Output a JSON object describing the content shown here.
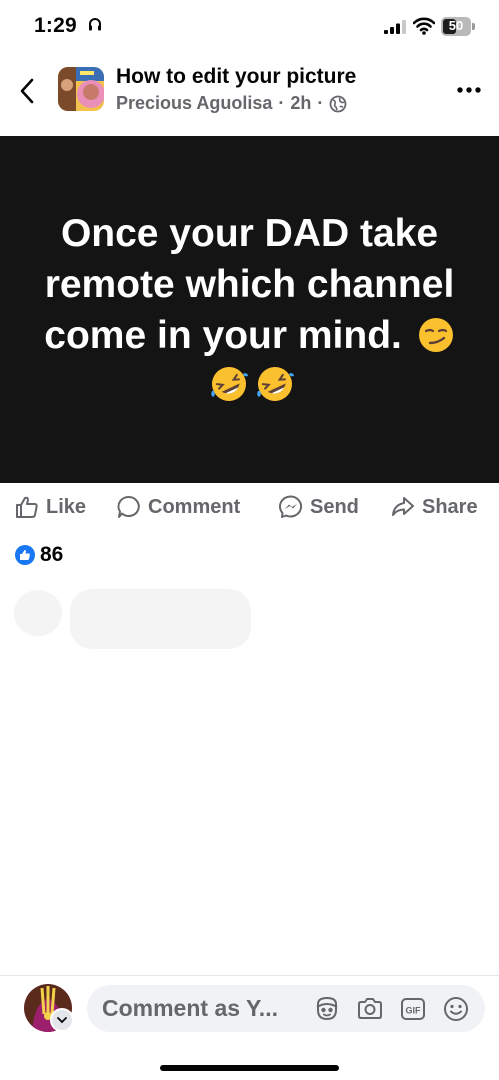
{
  "status_bar": {
    "time": "1:29",
    "battery": "50",
    "battery_level": 0.5
  },
  "header": {
    "title": "How to edit your picture",
    "author": "Precious Aguolisa",
    "time_ago": "2h",
    "separator": "·"
  },
  "post": {
    "text": "Once your DAD take remote which channel come in your mind.",
    "emojis": [
      "smirking-face",
      "rolling-on-floor-laughing",
      "rolling-on-floor-laughing"
    ],
    "background_color": "#141414"
  },
  "actions": {
    "like": "Like",
    "comment": "Comment",
    "send": "Send",
    "share": "Share"
  },
  "reactions": {
    "count": "86"
  },
  "composer": {
    "placeholder": "Comment as Y..."
  },
  "colors": {
    "accent": "#1877f2",
    "secondary_text": "#65676b"
  }
}
